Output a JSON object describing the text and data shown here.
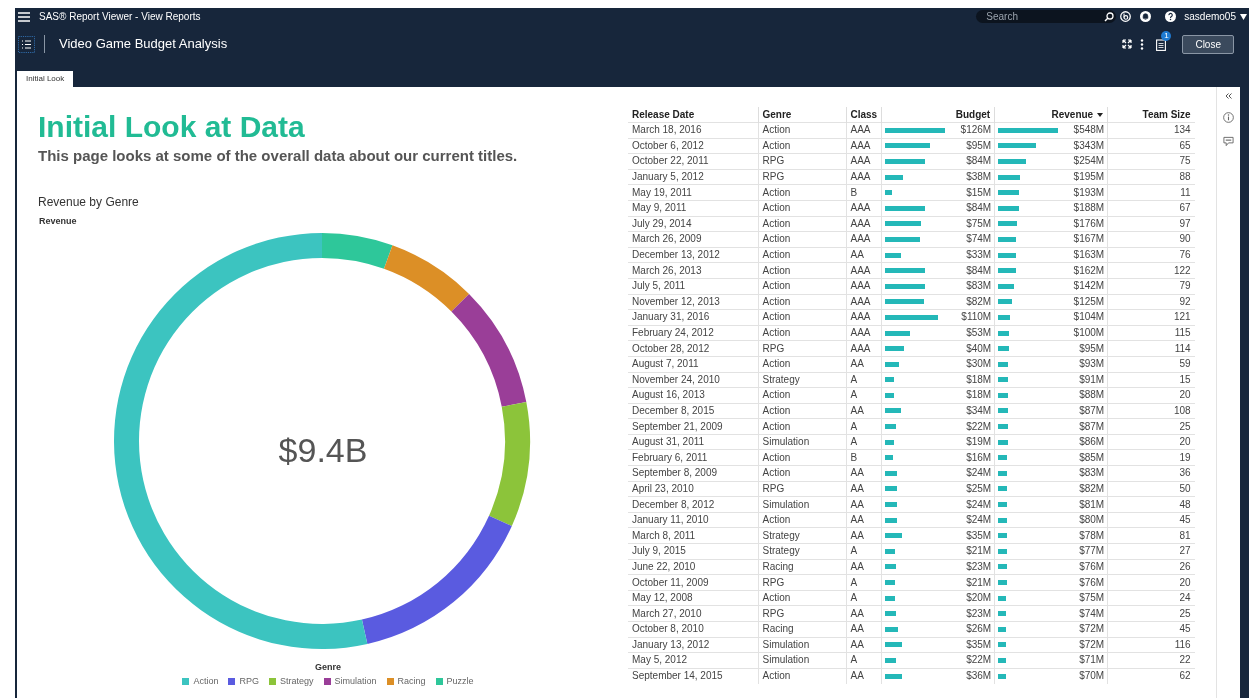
{
  "app_bar": {
    "title": "SAS® Report Viewer - View Reports",
    "search": {
      "placeholder": "Search"
    },
    "user": "sasdemo05"
  },
  "report_bar": {
    "title": "Video Game Budget Analysis",
    "notification_count": "1",
    "close_button": "Close"
  },
  "tabs": [
    {
      "label": "Initial Look",
      "selected": true
    }
  ],
  "page": {
    "heading": "Initial Look at Data",
    "subheading": "This page looks at some of the overall data about our current titles.",
    "donut": {
      "title": "Revenue by Genre",
      "measure": "Revenue",
      "total": "$9.4B",
      "legend_title": "Genre",
      "legend": [
        {
          "label": "Action",
          "color": "#3cc4c0"
        },
        {
          "label": "RPG",
          "color": "#5a5be0"
        },
        {
          "label": "Strategy",
          "color": "#8cc43a"
        },
        {
          "label": "Simulation",
          "color": "#9a3e98"
        },
        {
          "label": "Racing",
          "color": "#dc8f26"
        },
        {
          "label": "Puzzle",
          "color": "#2ec79a"
        }
      ]
    }
  },
  "table": {
    "columns": [
      {
        "label": "Release Date",
        "sorted": false
      },
      {
        "label": "Genre",
        "sorted": false
      },
      {
        "label": "Class",
        "sorted": false
      },
      {
        "label": "Budget",
        "sorted": false
      },
      {
        "label": "Revenue",
        "sorted": true
      },
      {
        "label": "Team Size",
        "sorted": false
      }
    ],
    "rows": [
      {
        "release_date": "March 18, 2016",
        "genre": "Action",
        "class": "AAA",
        "budget": "$126M",
        "revenue": "$548M",
        "team_size": "134"
      },
      {
        "release_date": "October 6, 2012",
        "genre": "Action",
        "class": "AAA",
        "budget": "$95M",
        "revenue": "$343M",
        "team_size": "65"
      },
      {
        "release_date": "October 22, 2011",
        "genre": "RPG",
        "class": "AAA",
        "budget": "$84M",
        "revenue": "$254M",
        "team_size": "75"
      },
      {
        "release_date": "January 5, 2012",
        "genre": "RPG",
        "class": "AAA",
        "budget": "$38M",
        "revenue": "$195M",
        "team_size": "88"
      },
      {
        "release_date": "May 19, 2011",
        "genre": "Action",
        "class": "B",
        "budget": "$15M",
        "revenue": "$193M",
        "team_size": "11"
      },
      {
        "release_date": "May 9, 2011",
        "genre": "Action",
        "class": "AAA",
        "budget": "$84M",
        "revenue": "$188M",
        "team_size": "67"
      },
      {
        "release_date": "July 29, 2014",
        "genre": "Action",
        "class": "AAA",
        "budget": "$75M",
        "revenue": "$176M",
        "team_size": "97"
      },
      {
        "release_date": "March 26, 2009",
        "genre": "Action",
        "class": "AAA",
        "budget": "$74M",
        "revenue": "$167M",
        "team_size": "90"
      },
      {
        "release_date": "December 13, 2012",
        "genre": "Action",
        "class": "AA",
        "budget": "$33M",
        "revenue": "$163M",
        "team_size": "76"
      },
      {
        "release_date": "March 26, 2013",
        "genre": "Action",
        "class": "AAA",
        "budget": "$84M",
        "revenue": "$162M",
        "team_size": "122"
      },
      {
        "release_date": "July 5, 2011",
        "genre": "Action",
        "class": "AAA",
        "budget": "$83M",
        "revenue": "$142M",
        "team_size": "79"
      },
      {
        "release_date": "November 12, 2013",
        "genre": "Action",
        "class": "AAA",
        "budget": "$82M",
        "revenue": "$125M",
        "team_size": "92"
      },
      {
        "release_date": "January 31, 2016",
        "genre": "Action",
        "class": "AAA",
        "budget": "$110M",
        "revenue": "$104M",
        "team_size": "121"
      },
      {
        "release_date": "February 24, 2012",
        "genre": "Action",
        "class": "AAA",
        "budget": "$53M",
        "revenue": "$100M",
        "team_size": "115"
      },
      {
        "release_date": "October 28, 2012",
        "genre": "RPG",
        "class": "AAA",
        "budget": "$40M",
        "revenue": "$95M",
        "team_size": "114"
      },
      {
        "release_date": "August 7, 2011",
        "genre": "Action",
        "class": "AA",
        "budget": "$30M",
        "revenue": "$93M",
        "team_size": "59"
      },
      {
        "release_date": "November 24, 2010",
        "genre": "Strategy",
        "class": "A",
        "budget": "$18M",
        "revenue": "$91M",
        "team_size": "15"
      },
      {
        "release_date": "August 16, 2013",
        "genre": "Action",
        "class": "A",
        "budget": "$18M",
        "revenue": "$88M",
        "team_size": "20"
      },
      {
        "release_date": "December 8, 2015",
        "genre": "Action",
        "class": "AA",
        "budget": "$34M",
        "revenue": "$87M",
        "team_size": "108"
      },
      {
        "release_date": "September 21, 2009",
        "genre": "Action",
        "class": "A",
        "budget": "$22M",
        "revenue": "$87M",
        "team_size": "25"
      },
      {
        "release_date": "August 31, 2011",
        "genre": "Simulation",
        "class": "A",
        "budget": "$19M",
        "revenue": "$86M",
        "team_size": "20"
      },
      {
        "release_date": "February 6, 2011",
        "genre": "Action",
        "class": "B",
        "budget": "$16M",
        "revenue": "$85M",
        "team_size": "19"
      },
      {
        "release_date": "September 8, 2009",
        "genre": "Action",
        "class": "AA",
        "budget": "$24M",
        "revenue": "$83M",
        "team_size": "36"
      },
      {
        "release_date": "April 23, 2010",
        "genre": "RPG",
        "class": "AA",
        "budget": "$25M",
        "revenue": "$82M",
        "team_size": "50"
      },
      {
        "release_date": "December 8, 2012",
        "genre": "Simulation",
        "class": "AA",
        "budget": "$24M",
        "revenue": "$81M",
        "team_size": "48"
      },
      {
        "release_date": "January 11, 2010",
        "genre": "Action",
        "class": "AA",
        "budget": "$24M",
        "revenue": "$80M",
        "team_size": "45"
      },
      {
        "release_date": "March 8, 2011",
        "genre": "Strategy",
        "class": "AA",
        "budget": "$35M",
        "revenue": "$78M",
        "team_size": "81"
      },
      {
        "release_date": "July 9, 2015",
        "genre": "Strategy",
        "class": "A",
        "budget": "$21M",
        "revenue": "$77M",
        "team_size": "27"
      },
      {
        "release_date": "June 22, 2010",
        "genre": "Racing",
        "class": "AA",
        "budget": "$23M",
        "revenue": "$76M",
        "team_size": "26"
      },
      {
        "release_date": "October 11, 2009",
        "genre": "RPG",
        "class": "A",
        "budget": "$21M",
        "revenue": "$76M",
        "team_size": "20"
      },
      {
        "release_date": "May 12, 2008",
        "genre": "Action",
        "class": "A",
        "budget": "$20M",
        "revenue": "$75M",
        "team_size": "24"
      },
      {
        "release_date": "March 27, 2010",
        "genre": "RPG",
        "class": "AA",
        "budget": "$23M",
        "revenue": "$74M",
        "team_size": "25"
      },
      {
        "release_date": "October 8, 2010",
        "genre": "Racing",
        "class": "AA",
        "budget": "$26M",
        "revenue": "$72M",
        "team_size": "45"
      },
      {
        "release_date": "January 13, 2012",
        "genre": "Simulation",
        "class": "AA",
        "budget": "$35M",
        "revenue": "$72M",
        "team_size": "116"
      },
      {
        "release_date": "May 5, 2012",
        "genre": "Simulation",
        "class": "A",
        "budget": "$22M",
        "revenue": "$71M",
        "team_size": "22"
      },
      {
        "release_date": "September 14, 2015",
        "genre": "Action",
        "class": "AA",
        "budget": "$36M",
        "revenue": "$70M",
        "team_size": "62"
      }
    ]
  }
}
